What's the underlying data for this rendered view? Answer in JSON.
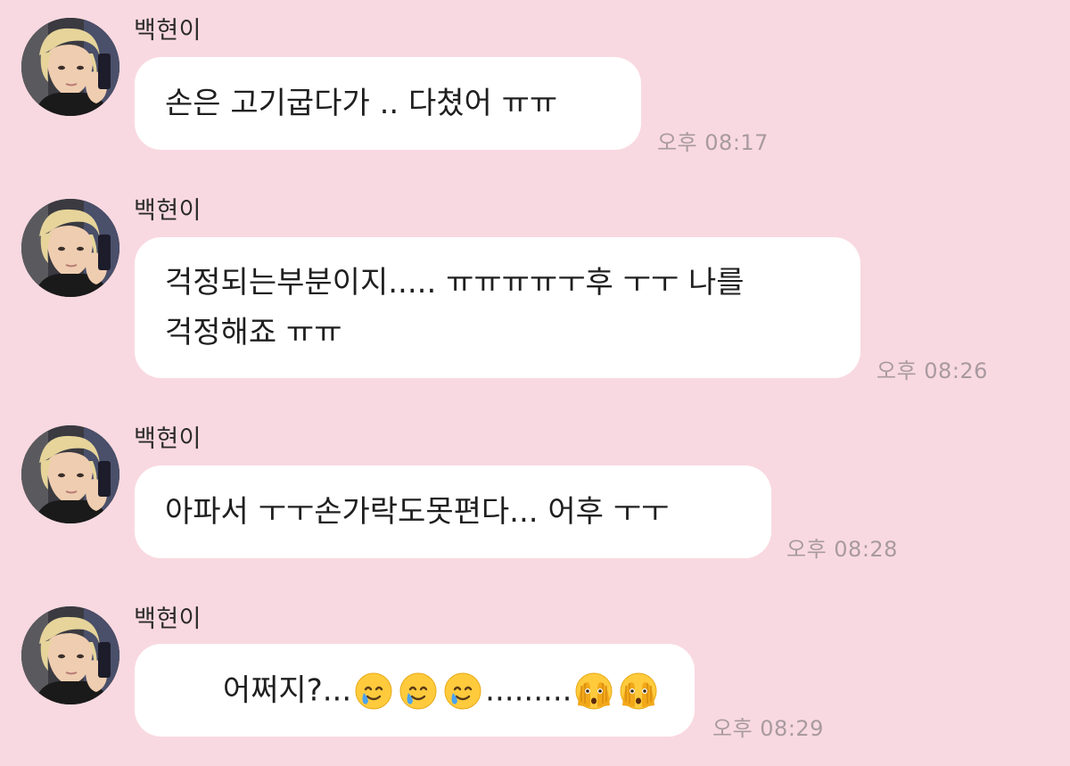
{
  "messages": [
    {
      "sender": "백현이",
      "text": "손은 고기굽다가 .. 다쳤어 ㅠㅠ",
      "time": "오후 08:17"
    },
    {
      "sender": "백현이",
      "text": "걱정되는부분이지..... ㅠㅠㅠㅠㅜ후 ㅜㅜ 나를\n걱정해죠 ㅠㅠ",
      "time": "오후 08:26"
    },
    {
      "sender": "백현이",
      "text": "아파서 ㅜㅜ손가락도못편다... 어후 ㅜㅜ",
      "time": "오후 08:28"
    },
    {
      "sender": "백현이",
      "text_prefix": "어쩌지?...",
      "text_middle": ".........",
      "emojis": [
        "smiling-face-with-tear-icon",
        "smiling-face-with-tear-icon",
        "smiling-face-with-tear-icon",
        "face-with-peeking-eye-icon",
        "face-with-peeking-eye-icon"
      ],
      "time": "오후 08:29"
    }
  ],
  "colors": {
    "background": "#f9d9e1",
    "bubble": "#ffffff",
    "time": "#a89aa0"
  }
}
